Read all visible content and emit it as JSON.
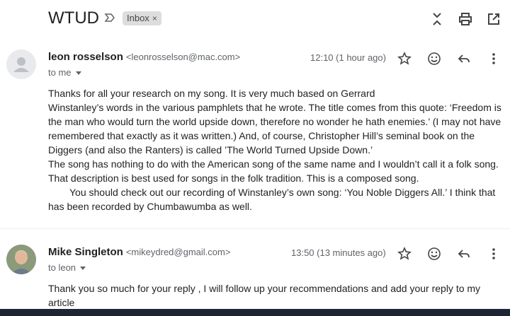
{
  "subject": "WTUD",
  "label": "Inbox",
  "label_remove": "×",
  "messages": [
    {
      "sender_name": "leon rosselson",
      "sender_email": "<leonrosselson@mac.com>",
      "time": "12:10 (1 hour ago)",
      "to": "to me",
      "body": [
        "Thanks for all your research on my song. It is very much based on Gerrard",
        "Winstanley’s words in the various pamphlets that he wrote. The title comes from this quote: ‘Freedom is the man who would turn the world upside down,  therefore no wonder he hath enemies.’ (I may not have remembered that exactly as it was written.) And, of course, Christopher Hill’s seminal book on the Diggers (and also the Ranters) is called ’The World Turned Upside Down.’",
        "The song has nothing to do with the American song of the same name and I wouldn’t call  it a folk song. That description is best used for songs in the folk tradition. This is a composed song.",
        "You should check out our recording of Winstanley’s  own  song: ‘You Noble Diggers All.’ I think that has been recorded by Chumbawumba as well."
      ]
    },
    {
      "sender_name": "Mike Singleton",
      "sender_email": "<mikeydred@gmail.com>",
      "time": "13:50 (13 minutes ago)",
      "to": "to leon",
      "body": [
        "Thank you so much for your reply , I will follow up your recommendations and add your reply to my article"
      ]
    }
  ]
}
